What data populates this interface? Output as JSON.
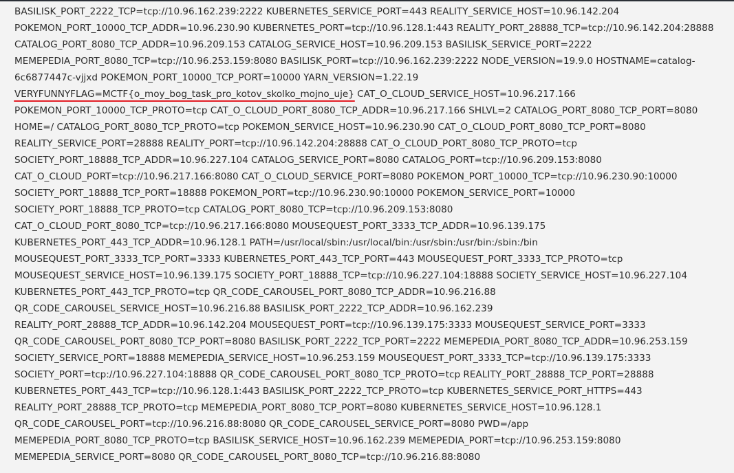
{
  "env_output": {
    "lines": [
      "BASILISK_PORT_2222_TCP=tcp://10.96.162.239:2222 KUBERNETES_SERVICE_PORT=443 REALITY_SERVICE_HOST=10.96.142.204",
      "POKEMON_PORT_10000_TCP_ADDR=10.96.230.90 KUBERNETES_PORT=tcp://10.96.128.1:443 REALITY_PORT_28888_TCP=tcp://10.96.142.204:28888",
      "CATALOG_PORT_8080_TCP_ADDR=10.96.209.153 CATALOG_SERVICE_HOST=10.96.209.153 BASILISK_SERVICE_PORT=2222",
      "MEMEPEDIA_PORT_8080_TCP=tcp://10.96.253.159:8080 BASILISK_PORT=tcp://10.96.162.239:2222 NODE_VERSION=19.9.0 HOSTNAME=catalog-",
      "6c6877447c-vjjxd POKEMON_PORT_10000_TCP_PORT=10000 YARN_VERSION=1.22.19",
      "VERYFUNNYFLAG=MCTF{o_moy_bog_task_pro_kotov_skolko_mojno_uje} CAT_O_CLOUD_SERVICE_HOST=10.96.217.166",
      "POKEMON_PORT_10000_TCP_PROTO=tcp CAT_O_CLOUD_PORT_8080_TCP_ADDR=10.96.217.166 SHLVL=2 CATALOG_PORT_8080_TCP_PORT=8080",
      "HOME=/ CATALOG_PORT_8080_TCP_PROTO=tcp POKEMON_SERVICE_HOST=10.96.230.90 CAT_O_CLOUD_PORT_8080_TCP_PORT=8080",
      "REALITY_SERVICE_PORT=28888 REALITY_PORT=tcp://10.96.142.204:28888 CAT_O_CLOUD_PORT_8080_TCP_PROTO=tcp",
      "SOCIETY_PORT_18888_TCP_ADDR=10.96.227.104 CATALOG_SERVICE_PORT=8080 CATALOG_PORT=tcp://10.96.209.153:8080",
      "CAT_O_CLOUD_PORT=tcp://10.96.217.166:8080 CAT_O_CLOUD_SERVICE_PORT=8080 POKEMON_PORT_10000_TCP=tcp://10.96.230.90:10000",
      "SOCIETY_PORT_18888_TCP_PORT=18888 POKEMON_PORT=tcp://10.96.230.90:10000 POKEMON_SERVICE_PORT=10000",
      "SOCIETY_PORT_18888_TCP_PROTO=tcp CATALOG_PORT_8080_TCP=tcp://10.96.209.153:8080",
      "CAT_O_CLOUD_PORT_8080_TCP=tcp://10.96.217.166:8080 MOUSEQUEST_PORT_3333_TCP_ADDR=10.96.139.175",
      "KUBERNETES_PORT_443_TCP_ADDR=10.96.128.1 PATH=/usr/local/sbin:/usr/local/bin:/usr/sbin:/usr/bin:/sbin:/bin",
      "MOUSEQUEST_PORT_3333_TCP_PORT=3333 KUBERNETES_PORT_443_TCP_PORT=443 MOUSEQUEST_PORT_3333_TCP_PROTO=tcp",
      "MOUSEQUEST_SERVICE_HOST=10.96.139.175 SOCIETY_PORT_18888_TCP=tcp://10.96.227.104:18888 SOCIETY_SERVICE_HOST=10.96.227.104",
      "KUBERNETES_PORT_443_TCP_PROTO=tcp QR_CODE_CAROUSEL_PORT_8080_TCP_ADDR=10.96.216.88",
      "QR_CODE_CAROUSEL_SERVICE_HOST=10.96.216.88 BASILISK_PORT_2222_TCP_ADDR=10.96.162.239",
      "REALITY_PORT_28888_TCP_ADDR=10.96.142.204 MOUSEQUEST_PORT=tcp://10.96.139.175:3333 MOUSEQUEST_SERVICE_PORT=3333",
      "QR_CODE_CAROUSEL_PORT_8080_TCP_PORT=8080 BASILISK_PORT_2222_TCP_PORT=2222 MEMEPEDIA_PORT_8080_TCP_ADDR=10.96.253.159",
      "SOCIETY_SERVICE_PORT=18888 MEMEPEDIA_SERVICE_HOST=10.96.253.159 MOUSEQUEST_PORT_3333_TCP=tcp://10.96.139.175:3333",
      "SOCIETY_PORT=tcp://10.96.227.104:18888 QR_CODE_CAROUSEL_PORT_8080_TCP_PROTO=tcp REALITY_PORT_28888_TCP_PORT=28888",
      "KUBERNETES_PORT_443_TCP=tcp://10.96.128.1:443 BASILISK_PORT_2222_TCP_PROTO=tcp KUBERNETES_SERVICE_PORT_HTTPS=443",
      "REALITY_PORT_28888_TCP_PROTO=tcp MEMEPEDIA_PORT_8080_TCP_PORT=8080 KUBERNETES_SERVICE_HOST=10.96.128.1",
      "QR_CODE_CAROUSEL_PORT=tcp://10.96.216.88:8080 QR_CODE_CAROUSEL_SERVICE_PORT=8080 PWD=/app",
      "MEMEPEDIA_PORT_8080_TCP_PROTO=tcp BASILISK_SERVICE_HOST=10.96.162.239 MEMEPEDIA_PORT=tcp://10.96.253.159:8080",
      "MEMEPEDIA_SERVICE_PORT=8080 QR_CODE_CAROUSEL_PORT_8080_TCP=tcp://10.96.216.88:8080"
    ]
  },
  "colors": {
    "background": "#f3f3f3",
    "text": "#2b2b2b",
    "annotation_underline": "#e31d25",
    "top_strip": "#2b2f36"
  }
}
